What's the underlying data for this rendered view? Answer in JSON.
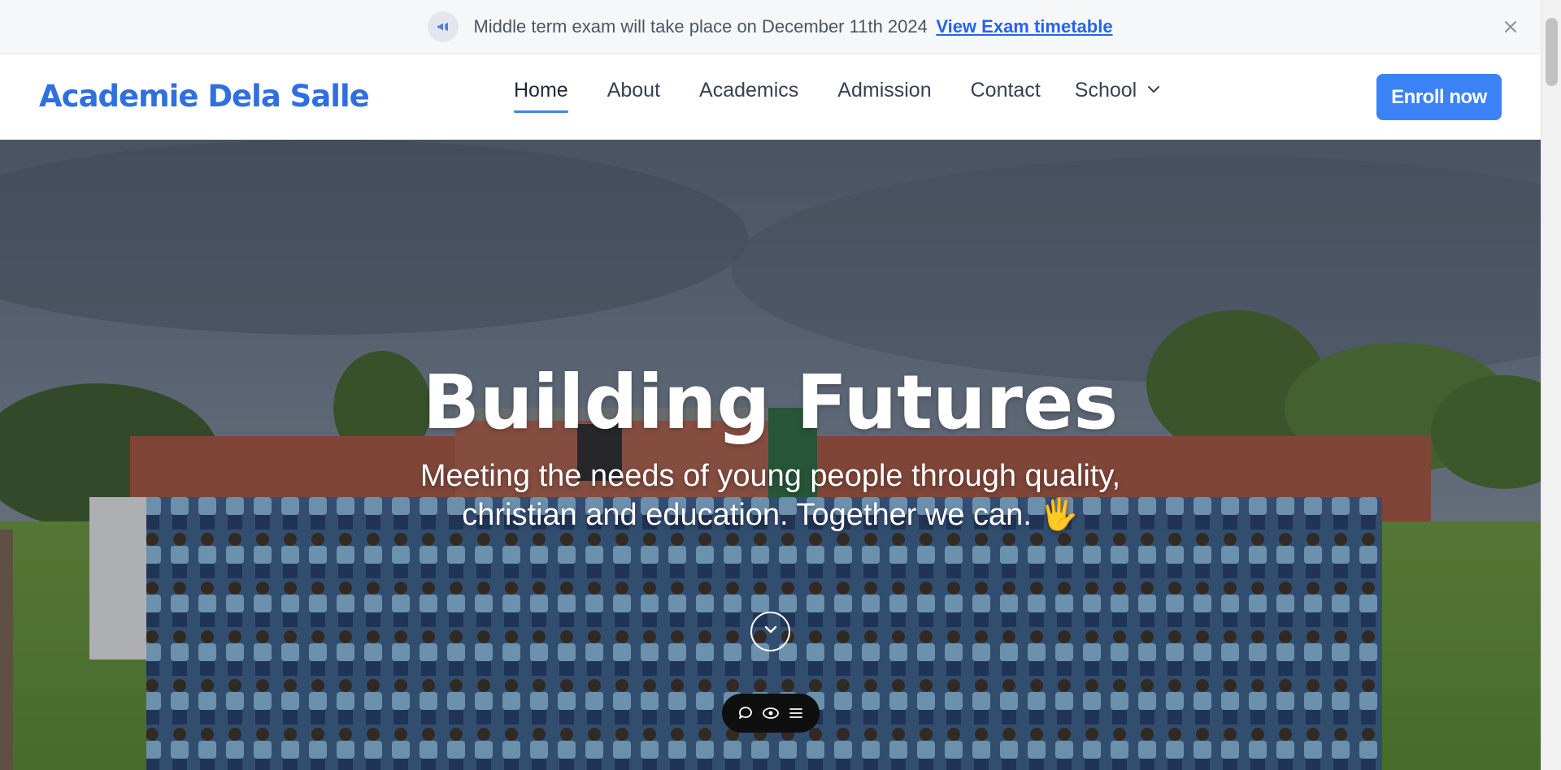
{
  "announcement": {
    "icon": "megaphone-icon",
    "text": "Middle term exam will take place on December 11th 2024",
    "link": "View Exam timetable",
    "close_icon": "close-icon"
  },
  "header": {
    "logo": "Academie Dela Salle",
    "nav": [
      {
        "label": "Home",
        "active": true
      },
      {
        "label": "About"
      },
      {
        "label": "Academics"
      },
      {
        "label": "Admission"
      },
      {
        "label": "Contact"
      },
      {
        "label": "School",
        "has_dropdown": true
      }
    ],
    "cta": "Enroll now"
  },
  "hero": {
    "title": "Building Futures",
    "subtitle_line1": "Meeting the needs of young people through quality,",
    "subtitle_line2": "christian and education. Together we can. 🖐",
    "scroll_icon": "chevron-down-icon",
    "toolbar": [
      "chat-icon",
      "eye-icon",
      "menu-icon"
    ]
  },
  "colors": {
    "brand": "#2f6fe0",
    "accent": "#3b82f6",
    "link": "#2563eb"
  }
}
